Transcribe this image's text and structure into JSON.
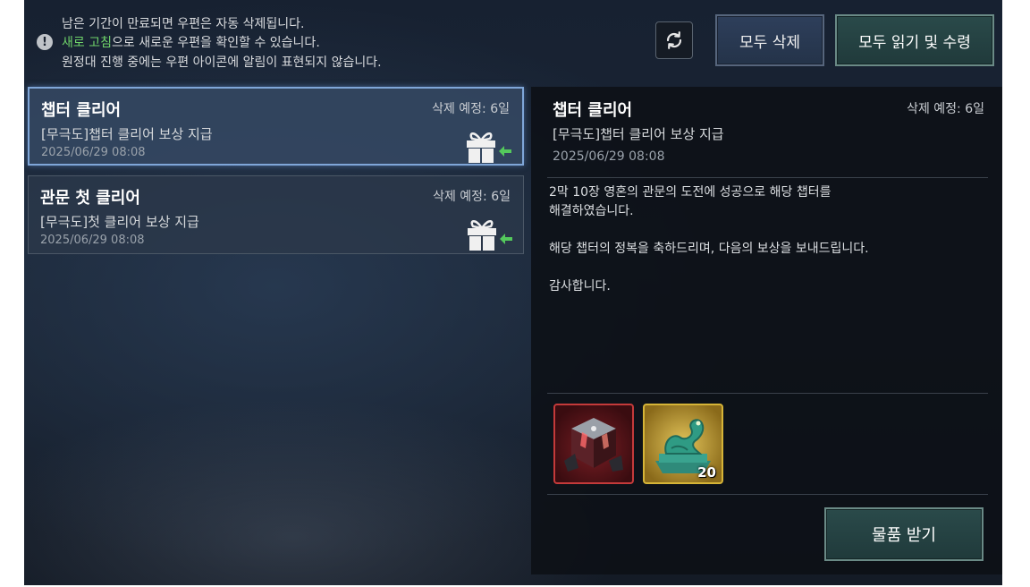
{
  "notice": {
    "line1": "남은 기간이 만료되면 우편은 자동 삭제됩니다.",
    "line2_highlight": "새로 고침",
    "line2_rest": "으로 새로운 우편을 확인할 수 있습니다.",
    "line3": "원정대 진행 중에는 우편 아이콘에 알림이 표현되지 않습니다.",
    "icon_text": "!",
    "icon": "exclamation-icon"
  },
  "toolbar": {
    "refresh_icon": "refresh-icon",
    "delete_all_label": "모두 삭제",
    "read_all_label": "모두 읽기 및 수령"
  },
  "mails": [
    {
      "title": "챕터 클리어",
      "expire": "삭제 예정: 6일",
      "subtitle": "[무극도]챕터 클리어 보상 지급",
      "date": "2025/06/29 08:08",
      "selected": true,
      "icon": "gift-icon"
    },
    {
      "title": "관문 첫 클리어",
      "expire": "삭제 예정: 6일",
      "subtitle": "[무극도]첫 클리어 보상 지급",
      "date": "2025/06/29 08:08",
      "selected": false,
      "icon": "gift-icon"
    }
  ],
  "detail": {
    "title": "챕터 클리어",
    "expire": "삭제 예정: 6일",
    "subtitle": "[무극도]챕터 클리어 보상 지급",
    "date": "2025/06/29 08:08",
    "body_line1": "2막 10장 영혼의 관문의 도전에 성공으로 해당 챕터를",
    "body_line2": "해결하였습니다.",
    "body_line3": "해당 챕터의 정복을 축하드리며, 다음의 보상을 보내드립니다.",
    "body_line4": "감사합니다.",
    "rewards": [
      {
        "icon": "crystal-cube-icon",
        "count": ""
      },
      {
        "icon": "jade-dragon-seal-icon",
        "count": "20"
      }
    ],
    "receive_label": "물품 받기"
  },
  "colors": {
    "highlight": "#6fd36a",
    "selected_border": "#7fa6d8",
    "primary_button": "#2a4a4a",
    "secondary_button": "#2e3f5b"
  }
}
